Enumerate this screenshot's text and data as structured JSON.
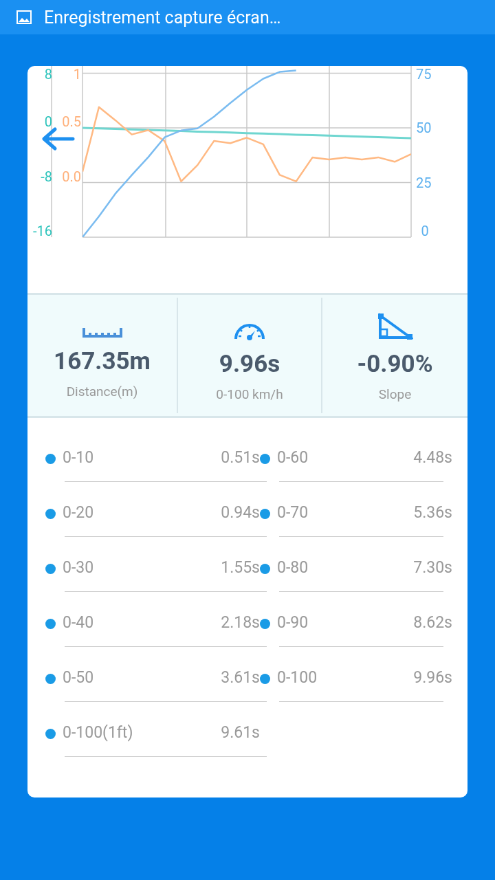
{
  "status_bar": {
    "title": "Enregistrement capture écran…"
  },
  "chart": {
    "left_ticks": [
      "8",
      "0",
      "-8",
      "-16"
    ],
    "middle_ticks": [
      "1",
      "0.5",
      "0.0"
    ],
    "chart_data": {
      "type": "line",
      "ylim": [
        0,
        78
      ],
      "grid": true,
      "yticks": [
        75,
        50,
        25,
        0
      ],
      "series": [
        {
          "color": "#7bbcf0",
          "values": [
            0,
            9.5,
            19.9,
            28.4,
            36.6,
            45.7,
            48.8,
            49.8,
            55.1,
            61.4,
            67.4,
            72.5,
            75.6,
            76.3,
            null,
            null,
            null,
            null,
            null,
            null,
            null
          ]
        },
        {
          "color": "#ffb983",
          "values": [
            30,
            59.5,
            53.5,
            47,
            49,
            44,
            25.5,
            33,
            44,
            43,
            45.5,
            42.5,
            28.5,
            25.5,
            36.5,
            35.5,
            36.5,
            35.5,
            36.5,
            34.5,
            38
          ]
        },
        {
          "color": "#6fd6d0",
          "values": [
            50,
            49.8,
            49.5,
            49.3,
            49.1,
            48.8,
            48.6,
            48.3,
            48.1,
            47.9,
            47.6,
            47.4,
            47.2,
            46.9,
            46.7,
            46.5,
            46.2,
            46,
            45.8,
            45.5,
            45.3
          ]
        }
      ]
    }
  },
  "stats": [
    {
      "kind": "distance",
      "value": "167.35m",
      "label": "Distance(m)"
    },
    {
      "kind": "speed",
      "value": "9.96s",
      "label": "0-100 km/h"
    },
    {
      "kind": "slope",
      "value": "-0.90%",
      "label": "Slope"
    }
  ],
  "splits": [
    {
      "label": "0-10",
      "time": "0.51s"
    },
    {
      "label": "0-60",
      "time": "4.48s"
    },
    {
      "label": "0-20",
      "time": "0.94s"
    },
    {
      "label": "0-70",
      "time": "5.36s"
    },
    {
      "label": "0-30",
      "time": "1.55s"
    },
    {
      "label": "0-80",
      "time": "7.30s"
    },
    {
      "label": "0-40",
      "time": "2.18s"
    },
    {
      "label": "0-90",
      "time": "8.62s"
    },
    {
      "label": "0-50",
      "time": "3.61s"
    },
    {
      "label": "0-100",
      "time": "9.96s"
    },
    {
      "label": "0-100(1ft)",
      "time": "9.61s"
    }
  ]
}
